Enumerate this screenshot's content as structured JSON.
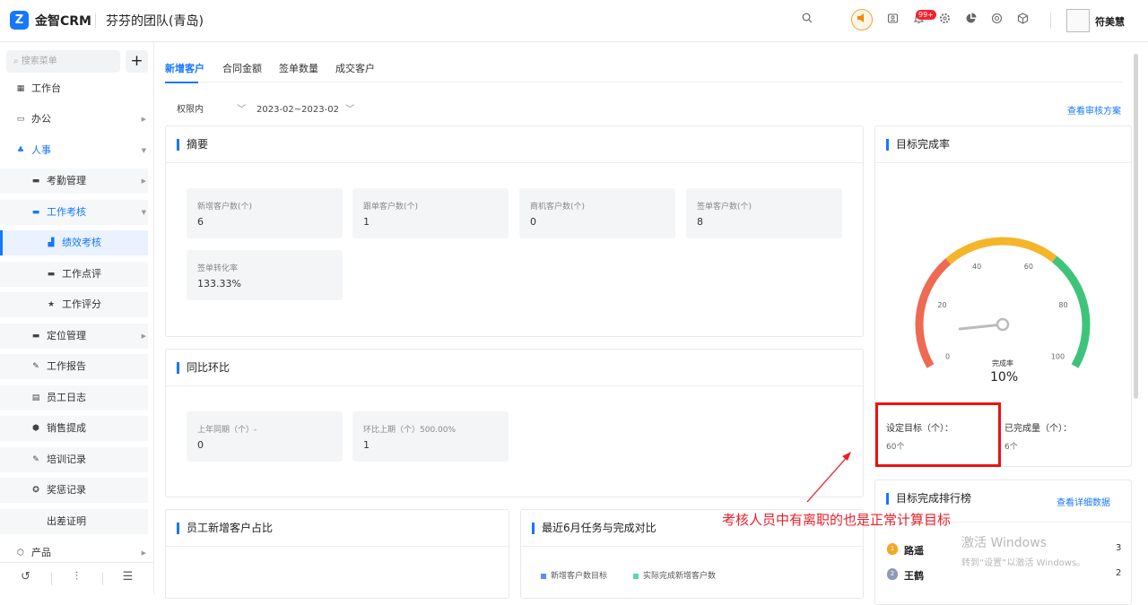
{
  "header": {
    "logo_letter": "Z",
    "app_name": "金智CRM",
    "team": "芬芬的团队(青岛)",
    "notification_count": "99+",
    "user_name": "符美慧",
    "icons": [
      "search-icon",
      "horn-icon",
      "contacts-icon",
      "bell-icon",
      "gear-icon",
      "pie-icon",
      "chrome-icon",
      "cube-icon"
    ]
  },
  "sidebar": {
    "search_placeholder": "搜索菜单",
    "plus": "+",
    "items": [
      {
        "label": "工作台",
        "icon": "dashboard-icon"
      },
      {
        "label": "办公",
        "icon": "office-icon"
      },
      {
        "label": "人事",
        "icon": "hr-icon"
      },
      {
        "label": "考勤管理",
        "icon": "folder-icon"
      },
      {
        "label": "工作考核",
        "icon": "folder-icon"
      },
      {
        "label": "绩效考核",
        "icon": "chart-icon"
      },
      {
        "label": "工作点评",
        "icon": "comment-icon"
      },
      {
        "label": "工作评分",
        "icon": "star-icon"
      },
      {
        "label": "定位管理",
        "icon": "folder-icon"
      },
      {
        "label": "工作报告",
        "icon": "report-icon"
      },
      {
        "label": "员工日志",
        "icon": "log-icon"
      },
      {
        "label": "销售提成",
        "icon": "commission-icon"
      },
      {
        "label": "培训记录",
        "icon": "training-icon"
      },
      {
        "label": "奖惩记录",
        "icon": "award-icon"
      },
      {
        "label": "出差证明",
        "icon": ""
      },
      {
        "label": "产品",
        "icon": "product-icon"
      }
    ]
  },
  "tabs": [
    "新增客户",
    "合同金额",
    "签单数量",
    "成交客户"
  ],
  "filters": {
    "scope": "权限内",
    "date_range": "2023-02~2023-02"
  },
  "view_plan_link": "查看审核方案",
  "summary": {
    "title": "摘要",
    "stats": [
      {
        "label": "新增客户数(个)",
        "value": "6"
      },
      {
        "label": "跟单客户数(个)",
        "value": "1"
      },
      {
        "label": "商机客户数(个)",
        "value": "0"
      },
      {
        "label": "签单客户数(个)",
        "value": "8"
      },
      {
        "label": "签单转化率",
        "value": "133.33%"
      }
    ]
  },
  "compare": {
    "title": "同比环比",
    "stats": [
      {
        "label": "上年同期（个）-",
        "value": "0"
      },
      {
        "label": "环比上期（个）500.00%",
        "value": "1"
      }
    ]
  },
  "target": {
    "title": "目标完成率",
    "rate_label": "完成率",
    "rate_value": "10%",
    "gauge_min": 0,
    "gauge_max": 100,
    "gauge_value": 10,
    "ticks": [
      "0",
      "20",
      "40",
      "60",
      "80",
      "100"
    ],
    "colors": {
      "low": "#ef6a52",
      "mid": "#f5b52a",
      "high": "#3ec47a"
    },
    "set_label": "设定目标（个）：",
    "set_value": "60个",
    "done_label": "已完成量（个）：",
    "done_value": "6个"
  },
  "employee_share": {
    "title": "员工新增客户占比"
  },
  "trend": {
    "title": "最近6月任务与完成对比",
    "legend": [
      {
        "label": "新增客户数目标",
        "color": "#5b8ff9"
      },
      {
        "label": "实际完成新增客户数",
        "color": "#5ad8a6"
      }
    ]
  },
  "ranking": {
    "title": "目标完成排行榜",
    "link": "查看详细数据",
    "rows": [
      {
        "name": "路遥",
        "value": "3",
        "medal_color": "#f5a623"
      },
      {
        "name": "王鹤",
        "value": "2",
        "medal_color": "#8e98b8"
      }
    ]
  },
  "annotation": "考核人员中有离职的也是正常计算目标",
  "watermark": {
    "line1": "激活 Windows",
    "line2": "转到“设置”以激活 Windows。"
  }
}
